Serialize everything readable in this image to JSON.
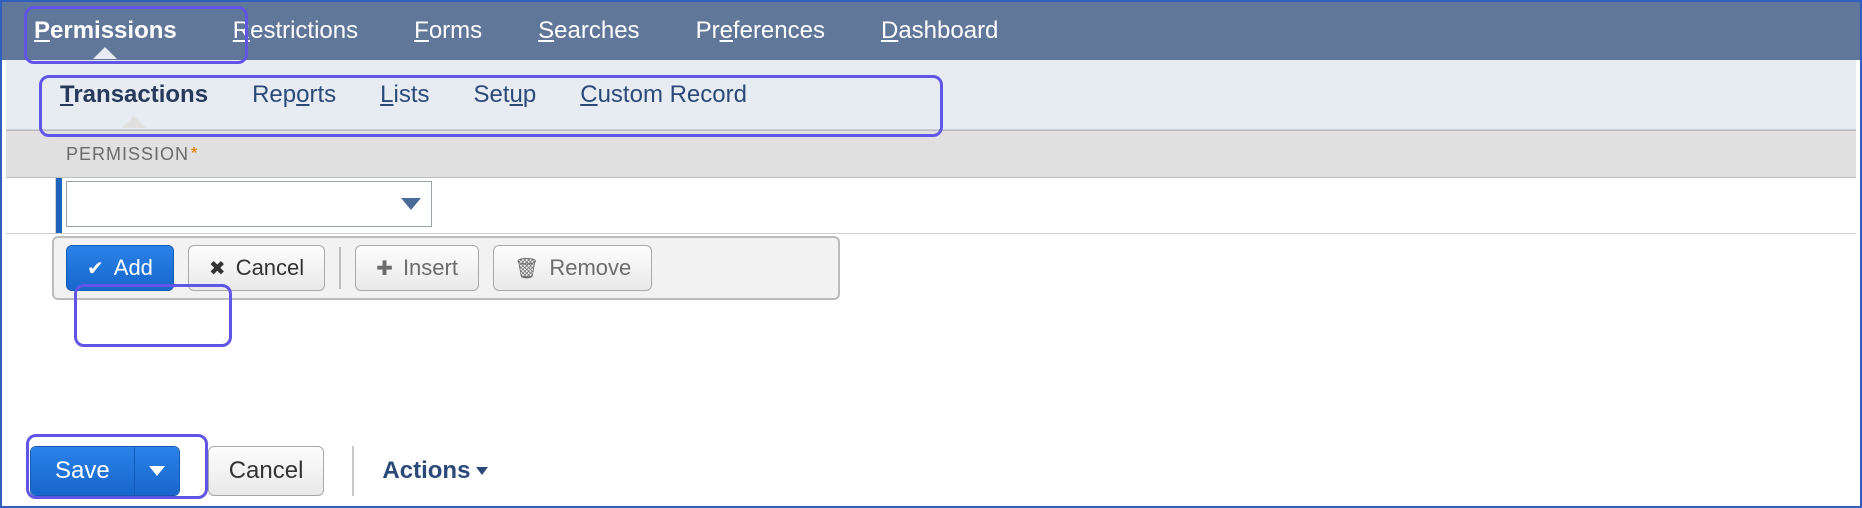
{
  "primary_tabs": {
    "permissions": "Permissions",
    "restrictions": "Restrictions",
    "forms": "Forms",
    "searches": "Searches",
    "preferences": "Preferences",
    "dashboard": "Dashboard"
  },
  "primary_tabs_keys": {
    "permissions": "P",
    "restrictions": "R",
    "forms": "F",
    "searches": "S",
    "preferences": "e",
    "dashboard": "D"
  },
  "sub_tabs": {
    "transactions": "Transactions",
    "reports": "Reports",
    "lists": "Lists",
    "setup": "Setup",
    "custom_record": "Custom Record"
  },
  "active_primary": "permissions",
  "active_sub": "transactions",
  "column_header": "PERMISSION",
  "required_marker": "*",
  "permission_dropdown_value": "",
  "inline_buttons": {
    "add": "Add",
    "cancel": "Cancel",
    "insert": "Insert",
    "remove": "Remove"
  },
  "footer": {
    "save": "Save",
    "cancel": "Cancel",
    "actions": "Actions"
  }
}
